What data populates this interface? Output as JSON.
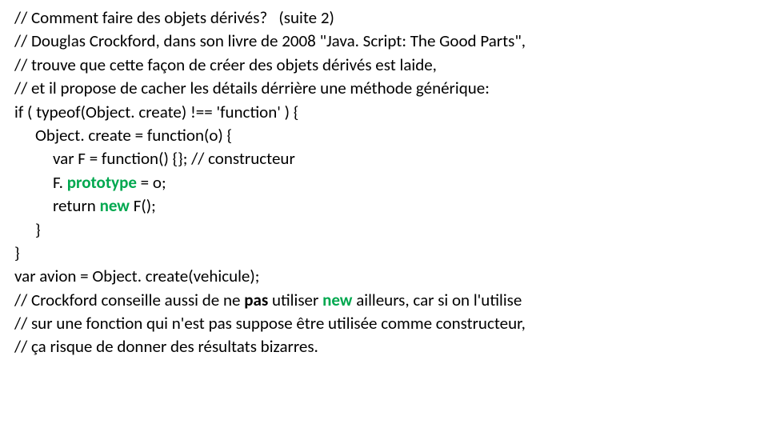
{
  "code": {
    "c1": "// Comment faire des objets dérivés?   (suite 2)",
    "c2": "// Douglas Crockford, dans son livre de 2008 \"Java. Script: The Good Parts\",",
    "c3": "// trouve que cette façon de créer des objets dérivés est laide,",
    "c4": "// et il propose de cacher les détails dérrière une méthode générique:",
    "l5": "if ( typeof(Object. create) !== 'function' ) {",
    "l6": "Object. create = function(o) {",
    "l7": "var F = function() {}; // constructeur",
    "l8a": "F. ",
    "l8kw": "prototype",
    "l8b": " = o;",
    "l9a": "return ",
    "l9kw": "new",
    "l9b": " F();",
    "l10": "}",
    "l11": "}",
    "l12": "var avion = Object. create(vehicule);",
    "c13a": "// Crockford conseille aussi de ne ",
    "c13b": "pas",
    "c13c": " utiliser ",
    "c13kw": "new",
    "c13d": " ailleurs, car si on l'utilise",
    "c14": "// sur une fonction qui n'est pas suppose être utilisée comme constructeur,",
    "c15": "// ça risque de donner des résultats bizarres."
  }
}
